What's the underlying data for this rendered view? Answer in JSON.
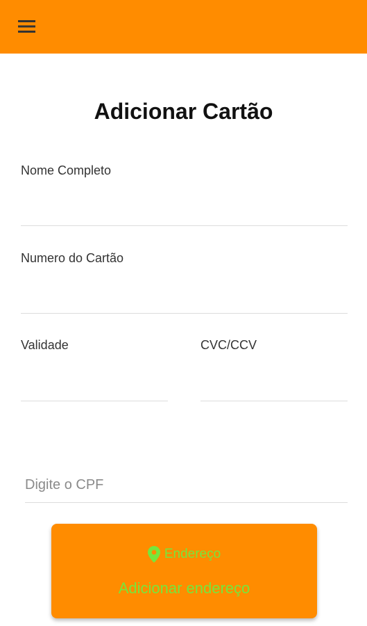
{
  "colors": {
    "app_bar": "#FF8C00",
    "accent_green": "#76E63C",
    "title_text": "#111111",
    "divider": "#dcdcdc"
  },
  "header": {
    "menu_icon": "hamburger-menu-icon"
  },
  "page": {
    "title": "Adicionar Cartão"
  },
  "form": {
    "full_name": {
      "label": "Nome Completo",
      "value": ""
    },
    "card_number": {
      "label": "Numero do Cartão",
      "value": ""
    },
    "validity": {
      "label": "Validade",
      "value": ""
    },
    "cvc": {
      "label": "CVC/CCV",
      "value": ""
    },
    "cpf": {
      "placeholder": "Digite o CPF",
      "value": ""
    }
  },
  "address": {
    "icon": "location-pin-icon",
    "caption": "Endereço",
    "action_label": "Adicionar endereço"
  }
}
